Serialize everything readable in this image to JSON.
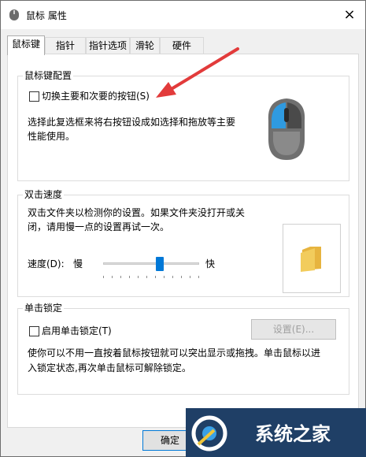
{
  "window": {
    "title": "鼠标 属性",
    "close_icon": "×"
  },
  "tabs": [
    {
      "label": "鼠标键",
      "active": true
    },
    {
      "label": "指针",
      "active": false
    },
    {
      "label": "指针选项",
      "active": false
    },
    {
      "label": "滑轮",
      "active": false
    },
    {
      "label": "硬件",
      "active": false
    }
  ],
  "buttons_group": {
    "title": "鼠标键配置",
    "swap_checkbox_label": "切换主要和次要的按钮(S)",
    "swap_checked": false,
    "description_line1": "选择此复选框来将右按钮设成如选择和拖放等主要",
    "description_line2": "性能使用。"
  },
  "double_click_group": {
    "title": "双击速度",
    "description_line1": "双击文件夹以检测你的设置。如果文件夹没打开或关",
    "description_line2": "闭，请用慢一点的设置再试一次。",
    "speed_label": "速度(D):",
    "slow_label": "慢",
    "fast_label": "快",
    "slider_value": 0.6
  },
  "click_lock_group": {
    "title": "单击锁定",
    "checkbox_label": "启用单击锁定(T)",
    "checked": false,
    "settings_button": "设置(E)...",
    "description_line1": "使你可以不用一直按着鼠标按钮就可以突出显示或拖拽。单击鼠标以进",
    "description_line2": "入锁定状态,再次单击鼠标可解除锁定。"
  },
  "footer": {
    "ok_button": "确定",
    "watermark_text": "系统之家"
  },
  "colors": {
    "accent_blue": "#0078d7",
    "annotation_arrow": "#e23b3b",
    "folder_yellow": "#f2cc5c"
  }
}
